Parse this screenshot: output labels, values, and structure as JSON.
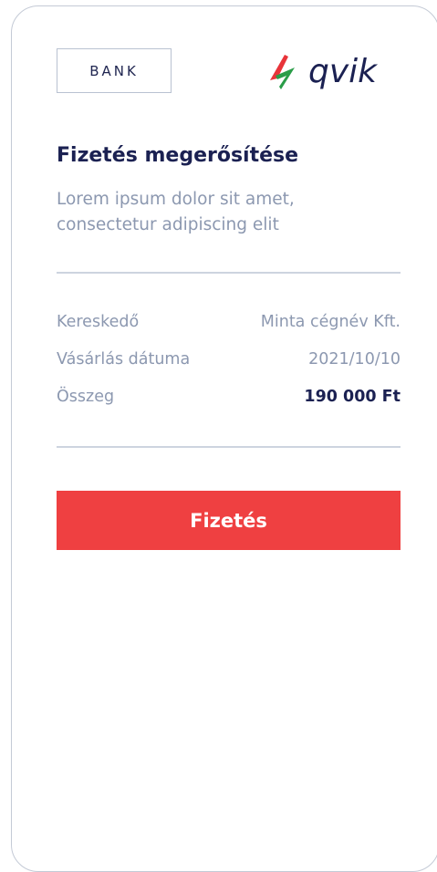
{
  "header": {
    "bank_label": "BANK",
    "logo_text": "qvik",
    "logo_icon": "lightning-bolt-icon",
    "logo_colors": {
      "red": "#e8343a",
      "green": "#2a9d48",
      "text": "#1b2152"
    }
  },
  "payment": {
    "title": "Fizetés megerősítése",
    "description": "Lorem ipsum dolor sit amet, consectetur adipiscing elit"
  },
  "details": [
    {
      "label": "Kereskedő",
      "value": "Minta cégnév Kft."
    },
    {
      "label": "Vásárlás dátuma",
      "value": "2021/10/10"
    },
    {
      "label": "Összeg",
      "value": "190 000 Ft"
    }
  ],
  "actions": {
    "pay_label": "Fizetés",
    "pay_color": "#ef4041"
  }
}
